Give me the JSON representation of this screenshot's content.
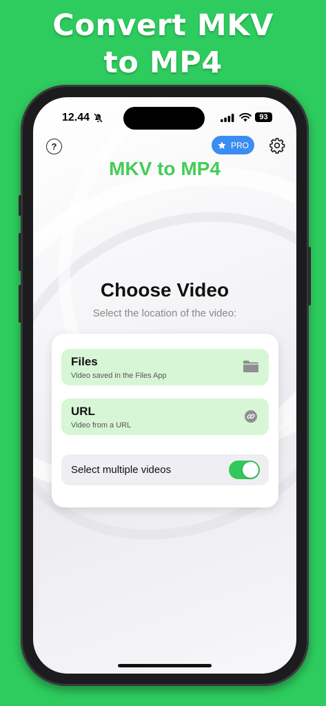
{
  "promo": {
    "line1": "Convert MKV",
    "line2": "to MP4"
  },
  "status_bar": {
    "time": "12.44",
    "battery": "93"
  },
  "header": {
    "help_label": "?",
    "pro_label": "PRO",
    "app_title": "MKV to MP4"
  },
  "main": {
    "title": "Choose Video",
    "subtitle": "Select the location of the video:",
    "options": [
      {
        "title": "Files",
        "subtitle": "Video saved in the Files App",
        "icon": "folder-icon"
      },
      {
        "title": "URL",
        "subtitle": "Video from a URL",
        "icon": "link-icon"
      }
    ],
    "multi_select": {
      "label": "Select multiple videos",
      "enabled": true
    }
  },
  "colors": {
    "background": "#2ecc5e",
    "app_title": "#44cc55",
    "pro_button": "#3b8df2",
    "option_bg": "#d7f6d5",
    "toggle_on": "#34c759"
  }
}
